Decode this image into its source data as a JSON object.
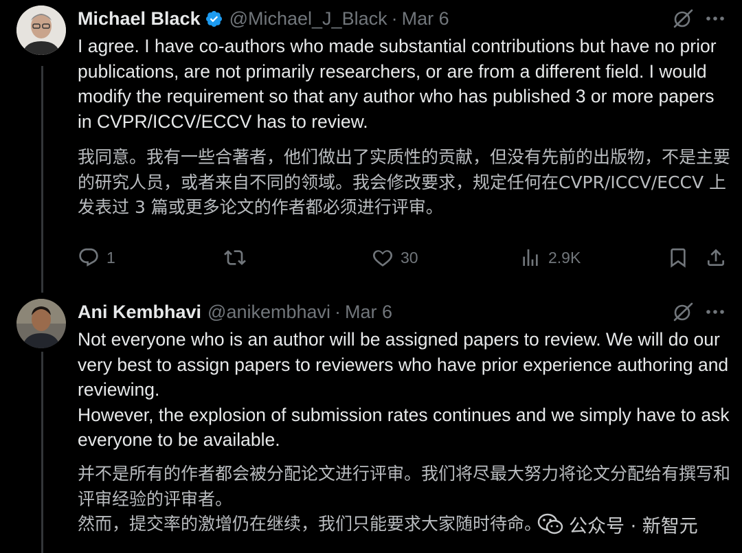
{
  "tweets": [
    {
      "author": {
        "name": "Michael Black",
        "handle": "@Michael_J_Black",
        "verified": true
      },
      "separator": "·",
      "date": "Mar 6",
      "text_en": "I agree. I have co-authors who made substantial contributions but have no prior publications, are not primarily researchers, or are from a different field. I would modify the requirement so that any author who has published 3 or more papers in CVPR/ICCV/ECCV has to review.",
      "text_zh": "我同意。我有一些合著者，他们做出了实质性的贡献，但没有先前的出版物，不是主要的研究人员，或者来自不同的领域。我会修改要求，规定任何在CVPR/ICCV/ECCV 上发表过 3 篇或更多论文的作者都必须进行评审。",
      "actions": {
        "replies": "1",
        "retweets": "",
        "likes": "30",
        "views": "2.9K"
      }
    },
    {
      "author": {
        "name": "Ani Kembhavi",
        "handle": "@anikembhavi",
        "verified": false
      },
      "separator": "·",
      "date": "Mar 6",
      "text_en": "Not everyone who is an author will be assigned papers to review. We will do our very best to assign papers to reviewers who have prior experience authoring and reviewing.\nHowever, the explosion of submission rates continues and we simply have to ask everyone to be available.",
      "text_zh": "并不是所有的作者都会被分配论文进行评审。我们将尽最大努力将论文分配给有撰写和评审经验的评审者。\n然而，提交率的激增仍在继续，我们只能要求大家随时待命。"
    }
  ],
  "watermark": {
    "text": "公众号 · 新智元"
  },
  "colors": {
    "background": "#000000",
    "text": "#e7e9ea",
    "muted": "#71767b",
    "verified": "#1d9bf0",
    "thread_line": "#333639"
  },
  "icons": [
    "verified-badge-icon",
    "grok-icon",
    "more-icon",
    "reply-icon",
    "retweet-icon",
    "like-icon",
    "views-icon",
    "bookmark-icon",
    "share-icon",
    "wechat-logo-icon"
  ]
}
